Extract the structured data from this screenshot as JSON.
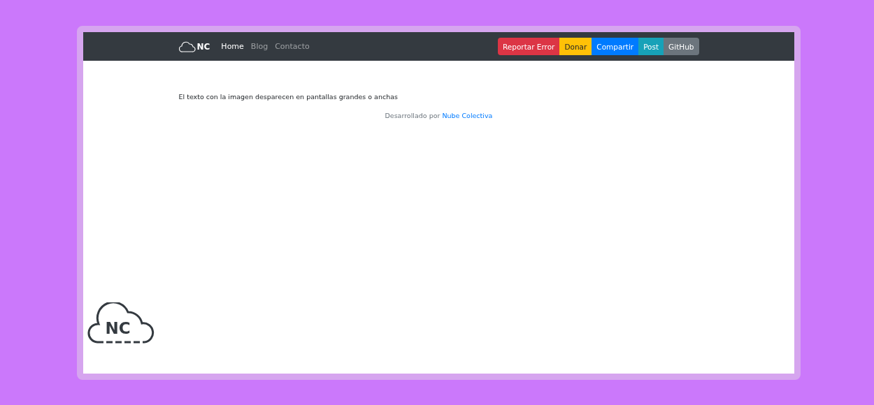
{
  "brand": {
    "text": "NC"
  },
  "nav": [
    {
      "label": "Home",
      "selected": true
    },
    {
      "label": "Blog",
      "selected": false
    },
    {
      "label": "Contacto",
      "selected": false
    }
  ],
  "buttons": [
    {
      "label": "Reportar Error",
      "color": "#dc3545"
    },
    {
      "label": "Donar",
      "color": "#ffc107"
    },
    {
      "label": "Compartir",
      "color": "#007bff"
    },
    {
      "label": "Post",
      "color": "#17a2b8"
    },
    {
      "label": "GitHub",
      "color": "#6c757d"
    }
  ],
  "message": "El texto con la imagen desparecen en pantallas grandes o anchas",
  "credit": {
    "text": "Desarrollado por",
    "link": "Nube Colectiva"
  },
  "logo": {
    "text": "NC"
  }
}
